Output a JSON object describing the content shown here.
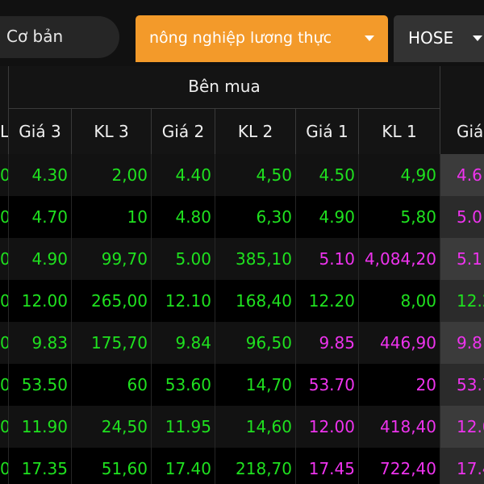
{
  "colors": {
    "accent": "#f39a2a",
    "price_up": "#1fe11f",
    "ceiling": "#ee33ee",
    "background": "#000000"
  },
  "topbar": {
    "basic_tab_label": "Cơ bản",
    "sector_tab_label": "nông nghiệp lương thực",
    "exchange_select_label": "HOSE"
  },
  "table": {
    "left_stub_header": "L",
    "group_header": "Bên mua",
    "columns": [
      "Giá 3",
      "KL 3",
      "Giá 2",
      "KL 2",
      "Giá 1",
      "KL 1",
      "Giá"
    ],
    "rows": [
      {
        "cells": [
          {
            "text": "0",
            "color": "green"
          },
          {
            "text": "4.30",
            "color": "green"
          },
          {
            "text": "2,00",
            "color": "green"
          },
          {
            "text": "4.40",
            "color": "green"
          },
          {
            "text": "4,50",
            "color": "green"
          },
          {
            "text": "4.50",
            "color": "green"
          },
          {
            "text": "4,90",
            "color": "green"
          },
          {
            "text": "4.6",
            "color": "magenta"
          }
        ]
      },
      {
        "cells": [
          {
            "text": "0",
            "color": "green"
          },
          {
            "text": "4.70",
            "color": "green"
          },
          {
            "text": "10",
            "color": "green"
          },
          {
            "text": "4.80",
            "color": "green"
          },
          {
            "text": "6,30",
            "color": "green"
          },
          {
            "text": "4.90",
            "color": "green"
          },
          {
            "text": "5,80",
            "color": "green"
          },
          {
            "text": "5.0",
            "color": "magenta"
          }
        ]
      },
      {
        "cells": [
          {
            "text": "0",
            "color": "green"
          },
          {
            "text": "4.90",
            "color": "green"
          },
          {
            "text": "99,70",
            "color": "green"
          },
          {
            "text": "5.00",
            "color": "green"
          },
          {
            "text": "385,10",
            "color": "green"
          },
          {
            "text": "5.10",
            "color": "magenta"
          },
          {
            "text": "4,084,20",
            "color": "magenta"
          },
          {
            "text": "5.1",
            "color": "magenta"
          }
        ]
      },
      {
        "cells": [
          {
            "text": "0",
            "color": "green"
          },
          {
            "text": "12.00",
            "color": "green"
          },
          {
            "text": "265,00",
            "color": "green"
          },
          {
            "text": "12.10",
            "color": "green"
          },
          {
            "text": "168,40",
            "color": "green"
          },
          {
            "text": "12.20",
            "color": "green"
          },
          {
            "text": "8,00",
            "color": "green"
          },
          {
            "text": "12.2",
            "color": "green"
          }
        ]
      },
      {
        "cells": [
          {
            "text": "0",
            "color": "green"
          },
          {
            "text": "9.83",
            "color": "green"
          },
          {
            "text": "175,70",
            "color": "green"
          },
          {
            "text": "9.84",
            "color": "green"
          },
          {
            "text": "96,50",
            "color": "green"
          },
          {
            "text": "9.85",
            "color": "magenta"
          },
          {
            "text": "446,90",
            "color": "magenta"
          },
          {
            "text": "9.8",
            "color": "magenta"
          }
        ]
      },
      {
        "cells": [
          {
            "text": "0",
            "color": "green"
          },
          {
            "text": "53.50",
            "color": "green"
          },
          {
            "text": "60",
            "color": "green"
          },
          {
            "text": "53.60",
            "color": "green"
          },
          {
            "text": "14,70",
            "color": "green"
          },
          {
            "text": "53.70",
            "color": "magenta"
          },
          {
            "text": "20",
            "color": "magenta"
          },
          {
            "text": "53.7",
            "color": "magenta"
          }
        ]
      },
      {
        "cells": [
          {
            "text": "0",
            "color": "green"
          },
          {
            "text": "11.90",
            "color": "green"
          },
          {
            "text": "24,50",
            "color": "green"
          },
          {
            "text": "11.95",
            "color": "green"
          },
          {
            "text": "14,60",
            "color": "green"
          },
          {
            "text": "12.00",
            "color": "magenta"
          },
          {
            "text": "418,40",
            "color": "magenta"
          },
          {
            "text": "12.0",
            "color": "magenta"
          }
        ]
      },
      {
        "cells": [
          {
            "text": "0",
            "color": "green"
          },
          {
            "text": "17.35",
            "color": "green"
          },
          {
            "text": "51,60",
            "color": "green"
          },
          {
            "text": "17.40",
            "color": "green"
          },
          {
            "text": "218,70",
            "color": "green"
          },
          {
            "text": "17.45",
            "color": "magenta"
          },
          {
            "text": "722,40",
            "color": "magenta"
          },
          {
            "text": "17.4",
            "color": "magenta"
          }
        ]
      }
    ]
  }
}
